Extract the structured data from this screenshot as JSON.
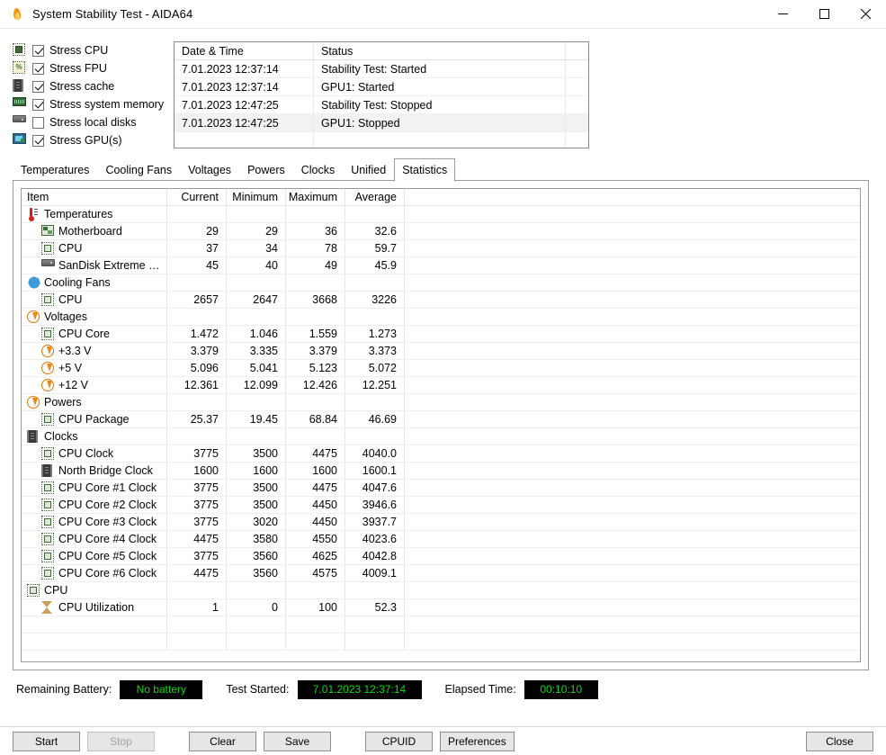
{
  "window": {
    "title": "System Stability Test - AIDA64",
    "app_icon": "flame-icon",
    "minimize_label": "–",
    "maximize_label": "□",
    "close_label": "✕"
  },
  "stress_options": [
    {
      "label": "Stress CPU",
      "checked": true,
      "icon": "cpu-chip-icon"
    },
    {
      "label": "Stress FPU",
      "checked": true,
      "icon": "fpu-chip-icon"
    },
    {
      "label": "Stress cache",
      "checked": true,
      "icon": "cache-chip-icon"
    },
    {
      "label": "Stress system memory",
      "checked": true,
      "icon": "memory-module-icon"
    },
    {
      "label": "Stress local disks",
      "checked": false,
      "icon": "hard-disk-icon"
    },
    {
      "label": "Stress GPU(s)",
      "checked": true,
      "icon": "gpu-monitor-icon"
    }
  ],
  "log": {
    "columns": [
      "Date & Time",
      "Status"
    ],
    "rows": [
      {
        "datetime": "7.01.2023 12:37:14",
        "status": "Stability Test: Started"
      },
      {
        "datetime": "7.01.2023 12:37:14",
        "status": "GPU1: Started"
      },
      {
        "datetime": "7.01.2023 12:47:25",
        "status": "Stability Test: Stopped"
      },
      {
        "datetime": "7.01.2023 12:47:25",
        "status": "GPU1: Stopped"
      }
    ]
  },
  "tabs": [
    {
      "label": "Temperatures",
      "active": false
    },
    {
      "label": "Cooling Fans",
      "active": false
    },
    {
      "label": "Voltages",
      "active": false
    },
    {
      "label": "Powers",
      "active": false
    },
    {
      "label": "Clocks",
      "active": false
    },
    {
      "label": "Unified",
      "active": false
    },
    {
      "label": "Statistics",
      "active": true
    }
  ],
  "statistics": {
    "columns": [
      "Item",
      "Current",
      "Minimum",
      "Maximum",
      "Average"
    ],
    "rows": [
      {
        "label": "Temperatures",
        "icon": "thermometer-icon",
        "level": 1,
        "current": "",
        "minimum": "",
        "maximum": "",
        "average": ""
      },
      {
        "label": "Motherboard",
        "icon": "motherboard-icon",
        "level": 2,
        "current": "29",
        "minimum": "29",
        "maximum": "36",
        "average": "32.6"
      },
      {
        "label": "CPU",
        "icon": "cpu-chip-icon",
        "level": 2,
        "current": "37",
        "minimum": "34",
        "maximum": "78",
        "average": "59.7"
      },
      {
        "label": "SanDisk Extreme Pro ...",
        "icon": "hard-disk-icon",
        "level": 2,
        "current": "45",
        "minimum": "40",
        "maximum": "49",
        "average": "45.9"
      },
      {
        "label": "Cooling Fans",
        "icon": "fan-icon",
        "level": 1,
        "current": "",
        "minimum": "",
        "maximum": "",
        "average": ""
      },
      {
        "label": "CPU",
        "icon": "cpu-chip-icon",
        "level": 2,
        "current": "2657",
        "minimum": "2647",
        "maximum": "3668",
        "average": "3226"
      },
      {
        "label": "Voltages",
        "icon": "bolt-icon",
        "level": 1,
        "current": "",
        "minimum": "",
        "maximum": "",
        "average": ""
      },
      {
        "label": "CPU Core",
        "icon": "cpu-chip-icon",
        "level": 2,
        "current": "1.472",
        "minimum": "1.046",
        "maximum": "1.559",
        "average": "1.273"
      },
      {
        "label": "+3.3 V",
        "icon": "bolt-icon",
        "level": 2,
        "current": "3.379",
        "minimum": "3.335",
        "maximum": "3.379",
        "average": "3.373"
      },
      {
        "label": "+5 V",
        "icon": "bolt-icon",
        "level": 2,
        "current": "5.096",
        "minimum": "5.041",
        "maximum": "5.123",
        "average": "5.072"
      },
      {
        "label": "+12 V",
        "icon": "bolt-icon",
        "level": 2,
        "current": "12.361",
        "minimum": "12.099",
        "maximum": "12.426",
        "average": "12.251"
      },
      {
        "label": "Powers",
        "icon": "bolt-icon",
        "level": 1,
        "current": "",
        "minimum": "",
        "maximum": "",
        "average": ""
      },
      {
        "label": "CPU Package",
        "icon": "cpu-chip-icon",
        "level": 2,
        "current": "25.37",
        "minimum": "19.45",
        "maximum": "68.84",
        "average": "46.69"
      },
      {
        "label": "Clocks",
        "icon": "cache-chip-icon",
        "level": 1,
        "current": "",
        "minimum": "",
        "maximum": "",
        "average": ""
      },
      {
        "label": "CPU Clock",
        "icon": "cpu-chip-icon",
        "level": 2,
        "current": "3775",
        "minimum": "3500",
        "maximum": "4475",
        "average": "4040.0"
      },
      {
        "label": "North Bridge Clock",
        "icon": "cache-chip-icon",
        "level": 2,
        "current": "1600",
        "minimum": "1600",
        "maximum": "1600",
        "average": "1600.1"
      },
      {
        "label": "CPU Core #1 Clock",
        "icon": "cpu-chip-icon",
        "level": 2,
        "current": "3775",
        "minimum": "3500",
        "maximum": "4475",
        "average": "4047.6"
      },
      {
        "label": "CPU Core #2 Clock",
        "icon": "cpu-chip-icon",
        "level": 2,
        "current": "3775",
        "minimum": "3500",
        "maximum": "4450",
        "average": "3946.6"
      },
      {
        "label": "CPU Core #3 Clock",
        "icon": "cpu-chip-icon",
        "level": 2,
        "current": "3775",
        "minimum": "3020",
        "maximum": "4450",
        "average": "3937.7"
      },
      {
        "label": "CPU Core #4 Clock",
        "icon": "cpu-chip-icon",
        "level": 2,
        "current": "4475",
        "minimum": "3580",
        "maximum": "4550",
        "average": "4023.6"
      },
      {
        "label": "CPU Core #5 Clock",
        "icon": "cpu-chip-icon",
        "level": 2,
        "current": "3775",
        "minimum": "3560",
        "maximum": "4625",
        "average": "4042.8"
      },
      {
        "label": "CPU Core #6 Clock",
        "icon": "cpu-chip-icon",
        "level": 2,
        "current": "4475",
        "minimum": "3560",
        "maximum": "4575",
        "average": "4009.1"
      },
      {
        "label": "CPU",
        "icon": "cpu-chip-icon",
        "level": 1,
        "current": "",
        "minimum": "",
        "maximum": "",
        "average": ""
      },
      {
        "label": "CPU Utilization",
        "icon": "hourglass-icon",
        "level": 2,
        "current": "1",
        "minimum": "0",
        "maximum": "100",
        "average": "52.3"
      }
    ],
    "empty_rows": 2
  },
  "status_bar": {
    "battery_label": "Remaining Battery:",
    "battery_value": "No battery",
    "started_label": "Test Started:",
    "started_value": "7.01.2023 12:37:14",
    "elapsed_label": "Elapsed Time:",
    "elapsed_value": "00:10:10",
    "value_color": "#12d612",
    "value_background": "#000000"
  },
  "buttons": {
    "start": "Start",
    "stop": "Stop",
    "clear": "Clear",
    "save": "Save",
    "cpuid": "CPUID",
    "preferences": "Preferences",
    "close": "Close"
  }
}
